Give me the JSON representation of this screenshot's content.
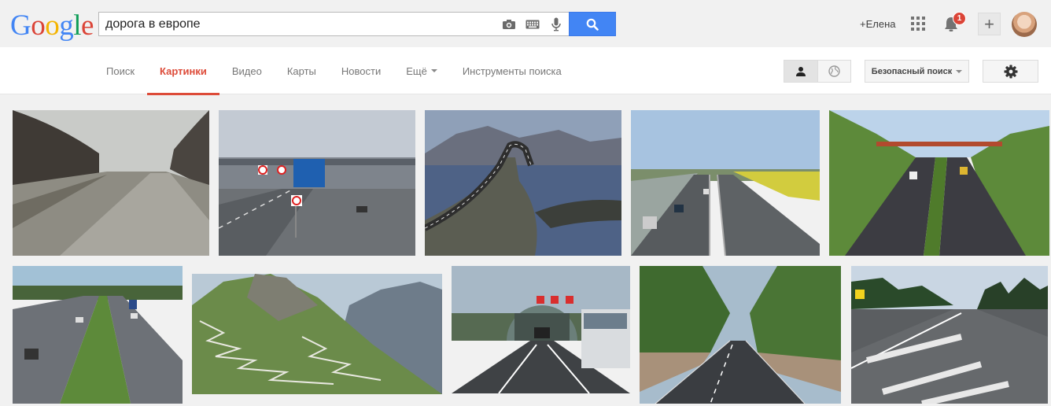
{
  "logo": {
    "letters": [
      "G",
      "o",
      "o",
      "g",
      "l",
      "e"
    ],
    "colors": [
      "#4285f4",
      "#db4437",
      "#f4b400",
      "#4285f4",
      "#0f9d58",
      "#db4437"
    ]
  },
  "search": {
    "query": "дорога в европе"
  },
  "header": {
    "user_link": "+Елена",
    "notification_count": "1"
  },
  "nav": {
    "tabs": [
      {
        "label": "Поиск"
      },
      {
        "label": "Картинки"
      },
      {
        "label": "Видео"
      },
      {
        "label": "Карты"
      },
      {
        "label": "Новости"
      },
      {
        "label": "Ещё"
      },
      {
        "label": "Инструменты поиска"
      }
    ],
    "active_tab": "Картинки",
    "safe_search_label": "Безопасный поиск"
  },
  "colors": {
    "accent_red": "#dd4b39",
    "search_blue": "#4285f4",
    "badge_red": "#db4437"
  },
  "results": {
    "row1_subjects": [
      "worn rural road",
      "toll gate with 50 signs",
      "curved bridge over fjord",
      "multi-lane highway",
      "highway through green cutting with bridge"
    ],
    "row2_subjects": [
      "divided motorway",
      "serpentine mountain road",
      "tunnel entrance with red signals",
      "road through forest",
      "wide road with crossings"
    ]
  }
}
